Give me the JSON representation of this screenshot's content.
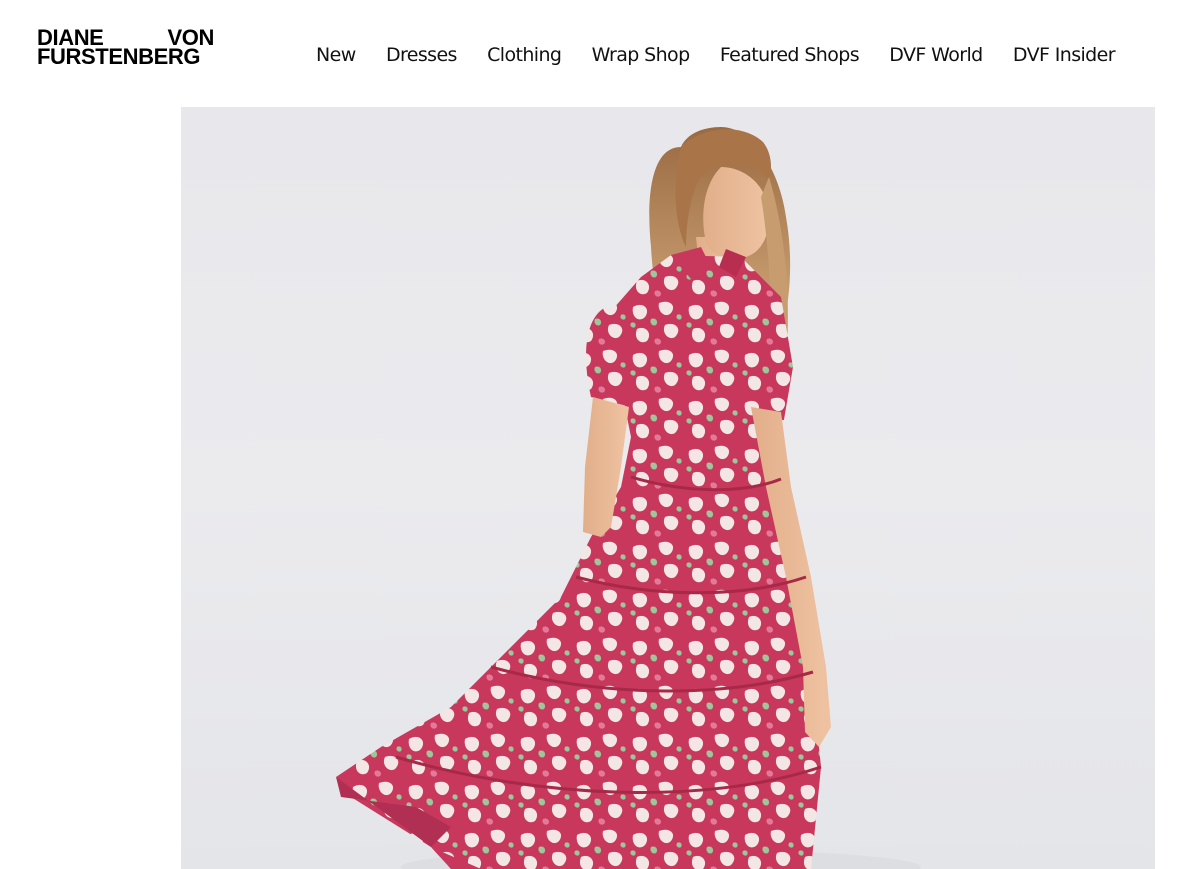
{
  "brand": {
    "line1_left": "DIANE",
    "line1_right": "VON",
    "line2": "FURSTENBERG"
  },
  "nav": {
    "items": [
      {
        "label": "New"
      },
      {
        "label": "Dresses"
      },
      {
        "label": "Clothing"
      },
      {
        "label": "Wrap Shop"
      },
      {
        "label": "Featured Shops"
      },
      {
        "label": "DVF World"
      },
      {
        "label": "DVF Insider"
      }
    ]
  },
  "hero": {
    "image": "model-in-pink-floral-tiered-shirt-dress",
    "colors": {
      "background": "#e8e8ec",
      "dress_pink": "#c8385d",
      "dress_cream": "#f3e6e4",
      "leaf_green": "#9cc79a",
      "skin": "#e8b896",
      "hair": "#b58457"
    }
  }
}
